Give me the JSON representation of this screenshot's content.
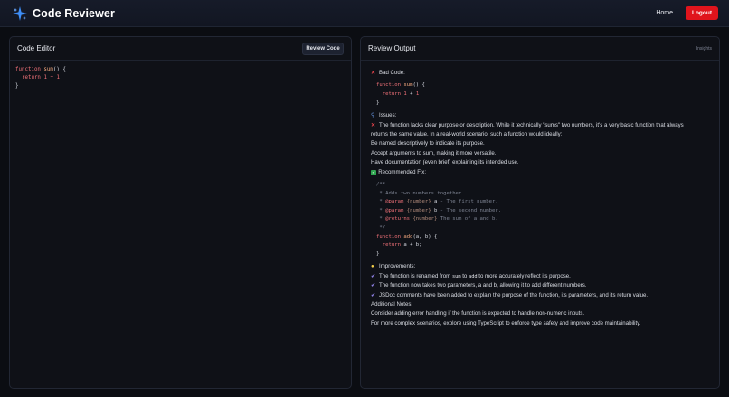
{
  "navbar": {
    "title": "Code Reviewer",
    "icon": "sparkle-icon",
    "home_label": "Home",
    "logout_label": "Logout",
    "colors": {
      "accent": "#e0141c",
      "brand_icon": "#3e8ef7"
    }
  },
  "editor": {
    "title": "Code Editor",
    "review_button_label": "Review Code",
    "code_lines": [
      "function sum() {",
      "  return 1 + 1",
      "}"
    ]
  },
  "output": {
    "title": "Review Output",
    "insights_label": "Insights",
    "bad_code_heading": "Bad Code:",
    "bad_code_lines": [
      "function sum() {",
      "  return 1 + 1",
      "}"
    ],
    "issues_heading": "Issues:",
    "issue_text_1": "The function lacks clear purpose or description. While it technically \"sums\" two numbers, it's a very basic function that always",
    "issue_text_2": "returns the same value. In a real-world scenario, such a function would ideally:",
    "issue_points": [
      "Be named descriptively to indicate its purpose.",
      "Accept arguments to sum, making it more versatile.",
      "Have documentation (even brief) explaining its intended use."
    ],
    "recommended_heading": "Recommended Fix:",
    "fix_doc": {
      "open": "/**",
      "desc": " * Adds two numbers together.",
      "param_tag": "@param",
      "type": "{number}",
      "param_a": "a",
      "param_a_desc": " - The first number.",
      "param_b": "b",
      "param_b_desc": " - The second number.",
      "returns_tag": "@returns",
      "returns_desc": " The sum of a and b.",
      "close": " */"
    },
    "fix_code": {
      "keyword_function": "function",
      "fn_name": "add",
      "sig_rest": "(a, b) {",
      "keyword_return": "return",
      "return_expr": " a + b;",
      "close": "}"
    },
    "improvements_heading": "Improvements:",
    "improvement_1_pre": "The function is renamed from ",
    "improvement_1_code_a": "sum",
    "improvement_1_mid": " to ",
    "improvement_1_code_b": "add",
    "improvement_1_post": " to more accurately reflect its purpose.",
    "improvement_2": "The function now takes two parameters, a and b, allowing it to add different numbers.",
    "improvement_3": "JSDoc comments have been added to explain the purpose of the function, its parameters, and its return value.",
    "notes_heading": "Additional Notes:",
    "notes": [
      "Consider adding error handling if the function is expected to handle non-numeric inputs.",
      "For more complex scenarios, explore using TypeScript to enforce type safety and improve code maintainability."
    ]
  }
}
